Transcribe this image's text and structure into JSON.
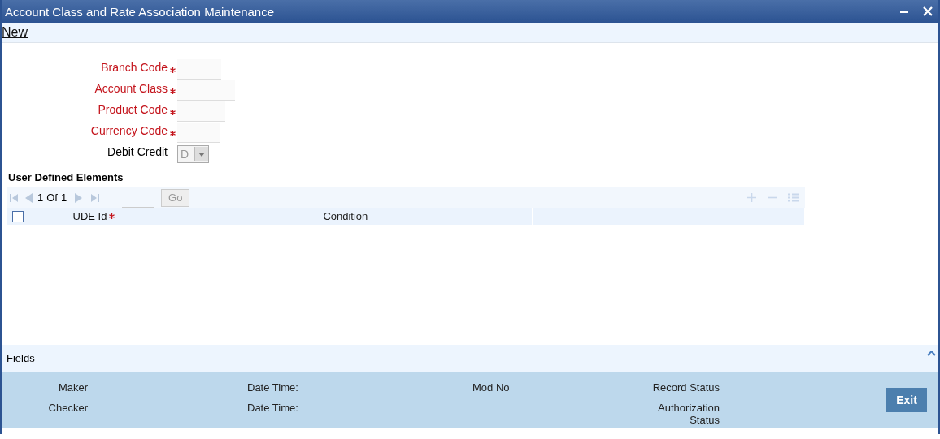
{
  "window": {
    "title": "Account Class and Rate Association Maintenance"
  },
  "toolbar": {
    "new_link": "New"
  },
  "form": {
    "fields": [
      {
        "label": "Branch Code",
        "required": true,
        "kind": "text"
      },
      {
        "label": "Account Class",
        "required": true,
        "kind": "text"
      },
      {
        "label": "Product Code",
        "required": true,
        "kind": "text"
      },
      {
        "label": "Currency Code",
        "required": true,
        "kind": "text"
      },
      {
        "label": "Debit Credit",
        "required": false,
        "kind": "select",
        "value": "D",
        "disabled": true
      }
    ]
  },
  "ude": {
    "title": "User Defined Elements",
    "pagination": {
      "page": "1",
      "of": "Of",
      "total": "1",
      "go_button": "Go"
    },
    "select_all": {
      "checked": false
    },
    "columns": [
      {
        "label": "UDE Id",
        "required": true
      },
      {
        "label": "Condition",
        "required": false
      }
    ]
  },
  "fields_bar": {
    "label": "Fields",
    "expanded": false
  },
  "audit": {
    "maker": "Maker",
    "maker_date_time": "Date Time:",
    "mod_no": "Mod No",
    "record_status": "Record Status",
    "checker": "Checker",
    "checker_date_time": "Date Time:",
    "authorization_status": "Authorization Status",
    "exit_button": "Exit"
  }
}
